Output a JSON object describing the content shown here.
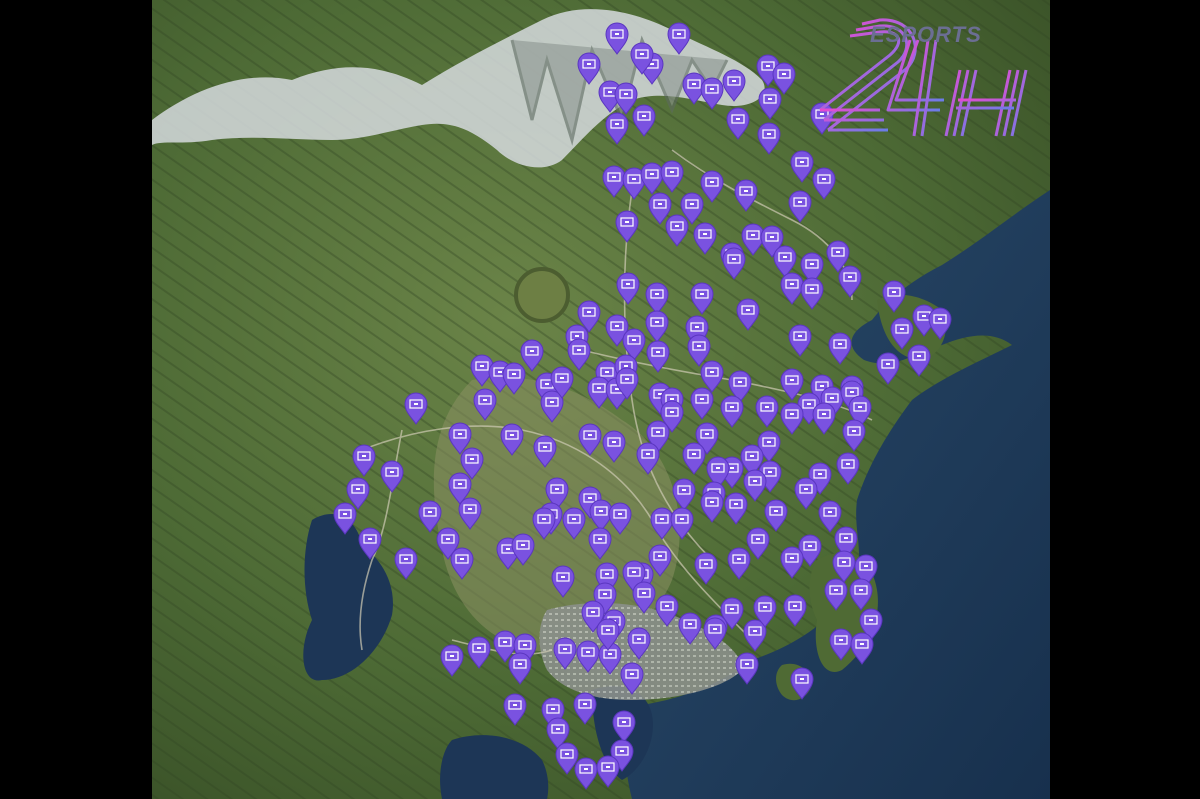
{
  "brand": {
    "top_text": "ESPORTS",
    "big_text": "24H"
  },
  "colors": {
    "background": "#000000",
    "pin": "#7a52e0",
    "pin_stroke": "#5a36c0",
    "sea": "#1f3a5a",
    "land": "#4f6a3a",
    "mountain_snow": "#d9dde0",
    "logo_gradient_start": "#e84ad0",
    "logo_gradient_end": "#6a7de8"
  },
  "map": {
    "marker_icon": "map-pin-marker-icon",
    "marker_glyph": "rectangle-card-icon"
  }
}
